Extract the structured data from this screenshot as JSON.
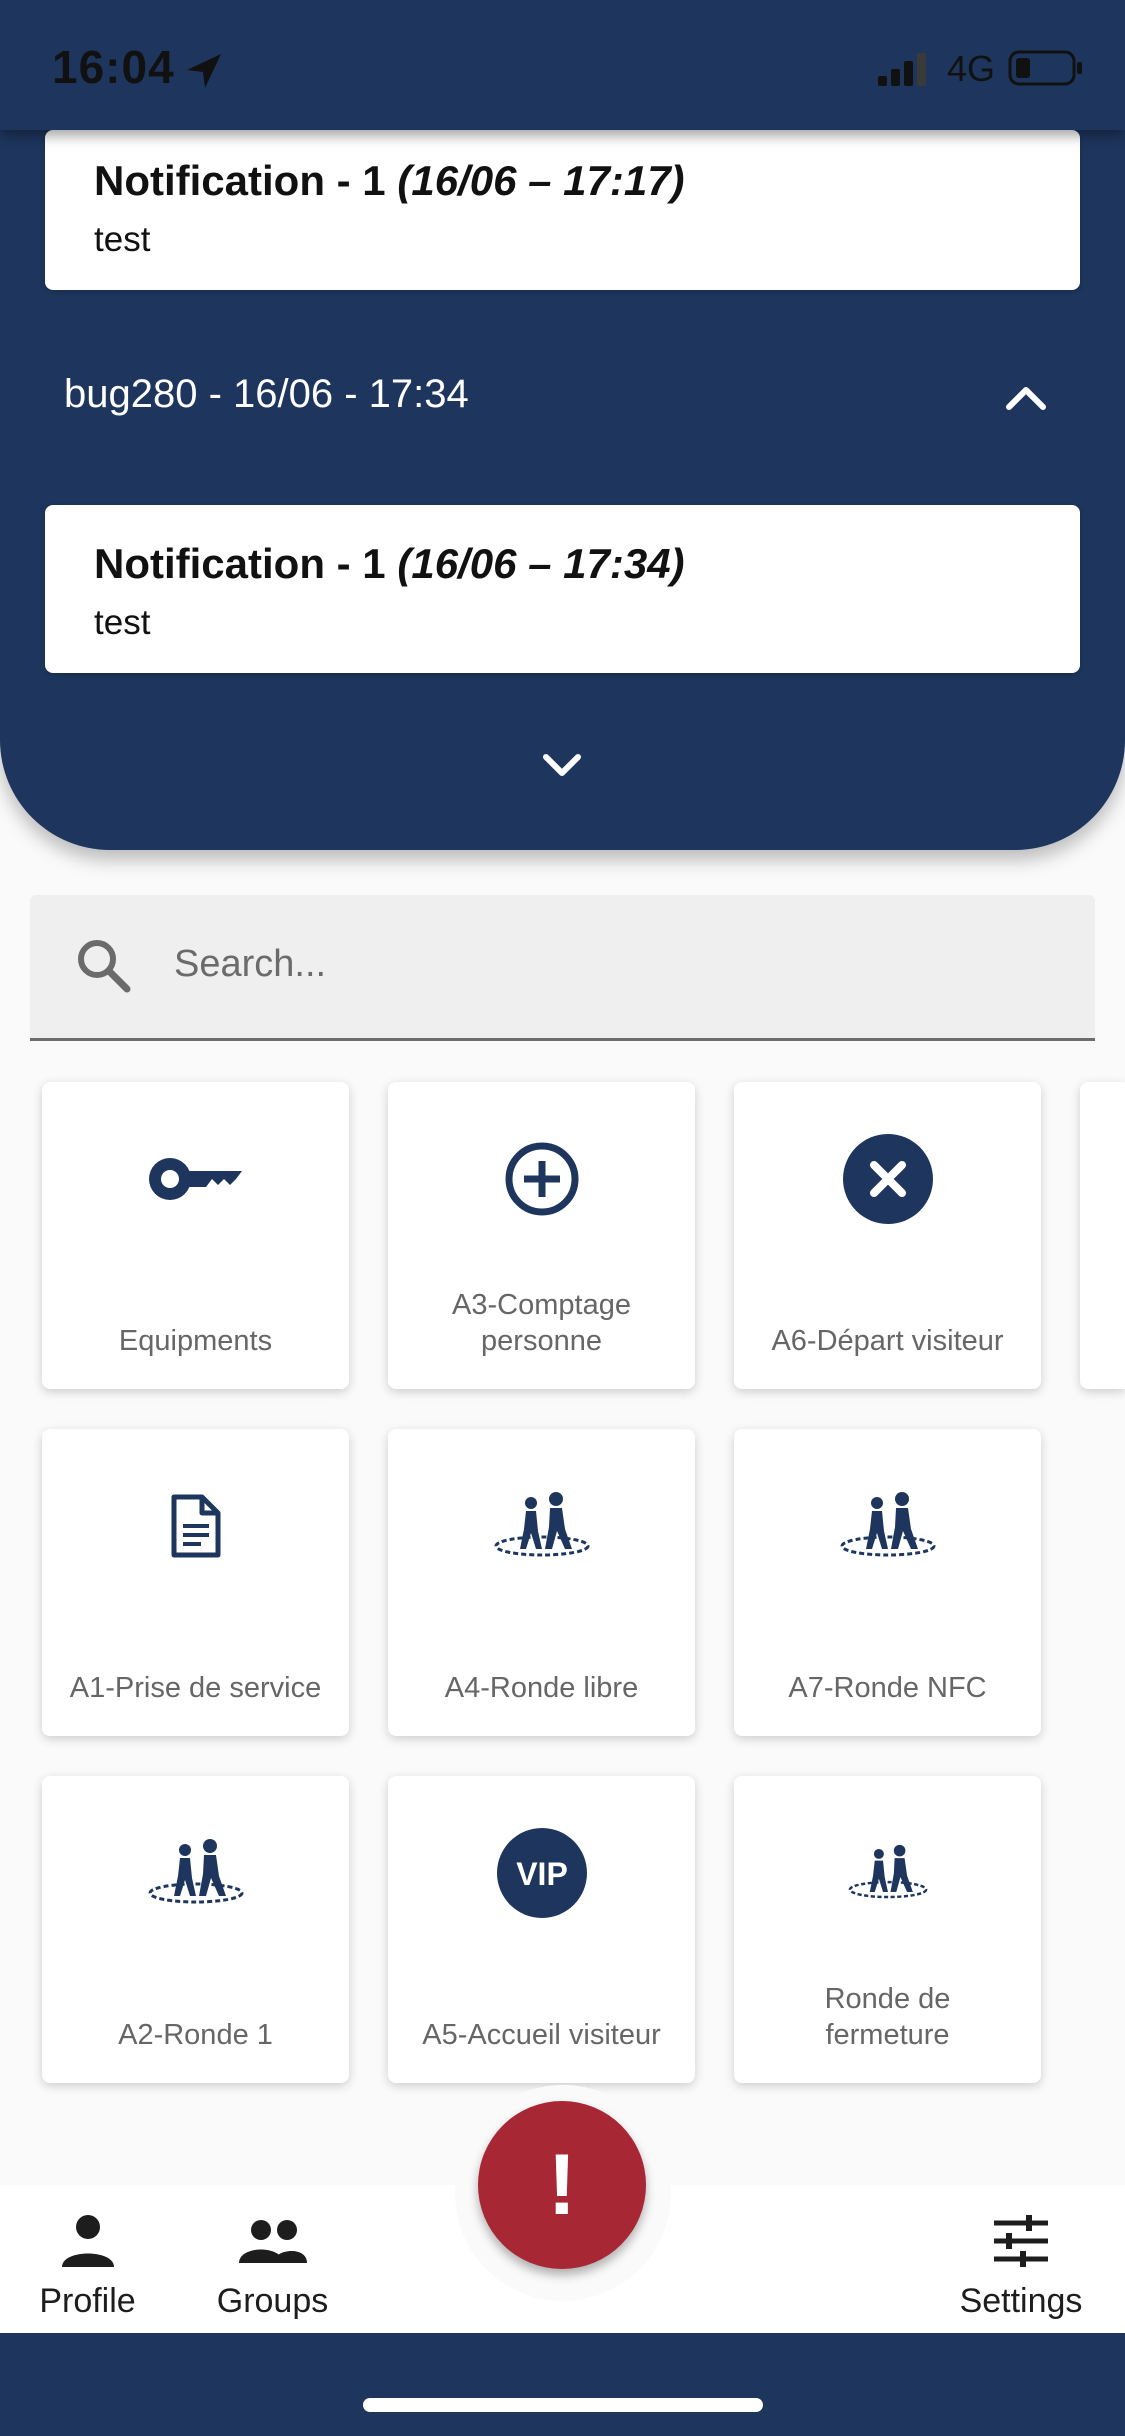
{
  "status_bar": {
    "time": "16:04",
    "network": "4G"
  },
  "notifications": {
    "group1_card": {
      "title": "Notification - 1",
      "time": "(16/06 – 17:17)",
      "body": "test"
    },
    "group2": {
      "header": "bug280 - 16/06 - 17:34",
      "card": {
        "title": "Notification - 1",
        "time": "(16/06 – 17:34)",
        "body": "test"
      }
    }
  },
  "search": {
    "placeholder": "Search..."
  },
  "tiles": [
    {
      "label": "Equipments",
      "icon": "key-icon"
    },
    {
      "label": "A3-Comptage personne",
      "icon": "plus-circle-icon"
    },
    {
      "label": "A6-Départ visiteur",
      "icon": "close-circle-icon"
    },
    {
      "label": "A1-Prise de service",
      "icon": "document-icon"
    },
    {
      "label": "A4-Ronde libre",
      "icon": "patrol-icon"
    },
    {
      "label": "A7-Ronde NFC",
      "icon": "patrol-icon"
    },
    {
      "label": "A2-Ronde 1",
      "icon": "patrol-icon"
    },
    {
      "label": "A5-Accueil visiteur",
      "icon": "vip-icon",
      "icon_text": "VIP"
    },
    {
      "label": "Ronde de fermeture",
      "icon": "patrol-icon"
    }
  ],
  "bottom_nav": {
    "profile": "Profile",
    "groups": "Groups",
    "settings": "Settings",
    "alert_symbol": "!"
  },
  "colors": {
    "primary": "#1e365d",
    "alert": "#a82734"
  }
}
